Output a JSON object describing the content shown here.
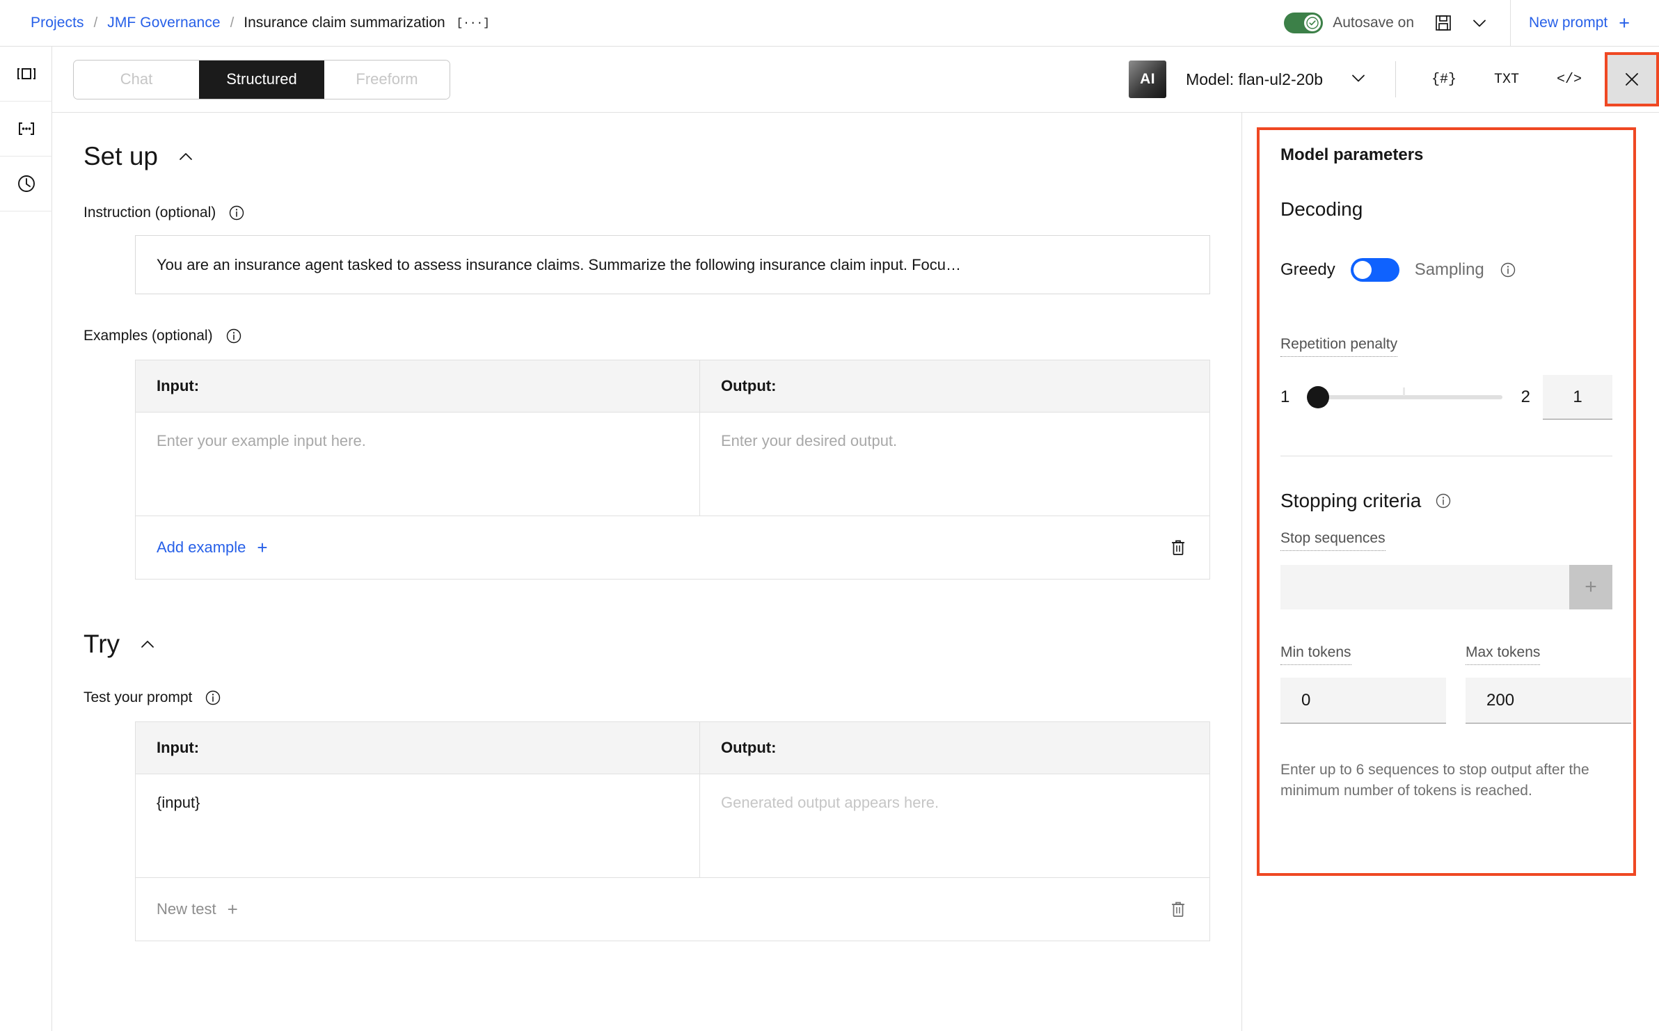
{
  "breadcrumb": {
    "projects": "Projects",
    "separator": "/",
    "project": "JMF Governance",
    "current": "Insurance claim summarization",
    "overflow": "[···]"
  },
  "topbar": {
    "autosave_label": "Autosave on",
    "save_icon": "save-icon",
    "chevron_icon": "chevron-down-icon",
    "new_prompt_label": "New prompt",
    "new_prompt_plus": "+",
    "accent_green": "#3c8048",
    "accent_blue": "#2760e8"
  },
  "rail": {
    "items": [
      {
        "name": "panel-toggle-icon"
      },
      {
        "name": "variables-icon"
      },
      {
        "name": "history-icon"
      }
    ]
  },
  "toolbar": {
    "tabs": [
      {
        "label": "Chat",
        "active": false
      },
      {
        "label": "Structured",
        "active": true
      },
      {
        "label": "Freeform",
        "active": false
      }
    ],
    "ai_badge": "AI",
    "model_label": "Model: flan-ul2-20b",
    "model_chevron": "chevron-down-icon",
    "glyphs": [
      {
        "label": "{#}",
        "name": "token-count-icon"
      },
      {
        "label": "TXT",
        "name": "text-view-icon"
      },
      {
        "label": "</>",
        "name": "code-view-icon"
      }
    ],
    "close_label": "×",
    "highlight_color": "#ef4823"
  },
  "setup": {
    "title": "Set up",
    "instruction_label": "Instruction (optional)",
    "instruction_value": "You are an insurance agent tasked to assess insurance claims. Summarize the following insurance claim input. Focu…",
    "examples_label": "Examples (optional)",
    "examples_table": {
      "headers": [
        "Input:",
        "Output:"
      ],
      "rows": [
        {
          "input_placeholder": "Enter your example input here.",
          "output_placeholder": "Enter your desired output."
        }
      ],
      "add_label": "Add example",
      "add_plus": "+",
      "delete_icon": "trash-icon"
    }
  },
  "try": {
    "title": "Try",
    "test_label": "Test your prompt",
    "test_table": {
      "headers": [
        "Input:",
        "Output:"
      ],
      "rows": [
        {
          "input_value": "{input}",
          "output_placeholder": "Generated output appears here."
        }
      ],
      "add_label": "New test",
      "add_plus": "+",
      "delete_icon": "trash-icon"
    }
  },
  "panel": {
    "title": "Model parameters",
    "decoding_heading": "Decoding",
    "decoding_left": "Greedy",
    "decoding_right": "Sampling",
    "decoding_selected": "Greedy",
    "repetition_penalty": {
      "label": "Repetition penalty",
      "min": "1",
      "max": "2",
      "value": "1"
    },
    "stopping": {
      "heading": "Stopping criteria",
      "stop_sequences_label": "Stop sequences",
      "stop_sequences_value": "",
      "add_plus": "+",
      "min_tokens_label": "Min tokens",
      "min_tokens_value": "0",
      "max_tokens_label": "Max tokens",
      "max_tokens_value": "200",
      "help_text": "Enter up to 6 sequences to stop output after the minimum number of tokens is reached."
    },
    "switch_color": "#0f62fe",
    "highlight_color": "#ef4823"
  }
}
